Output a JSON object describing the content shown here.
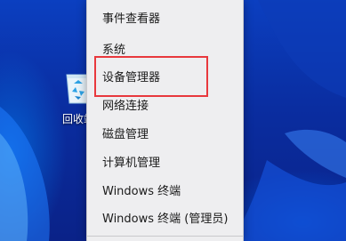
{
  "desktop": {
    "recycle_bin": {
      "icon": "recycle-bin-icon",
      "label": "回收站"
    }
  },
  "context_menu": {
    "items": [
      {
        "label": "事件查看器"
      },
      {
        "label": "系统"
      },
      {
        "label": "设备管理器",
        "highlighted": true
      },
      {
        "label": "网络连接"
      },
      {
        "label": "磁盘管理"
      },
      {
        "label": "计算机管理"
      },
      {
        "label": "Windows 终端"
      },
      {
        "label": "Windows 终端 (管理员)"
      }
    ],
    "highlight_color": "#e8383d"
  }
}
